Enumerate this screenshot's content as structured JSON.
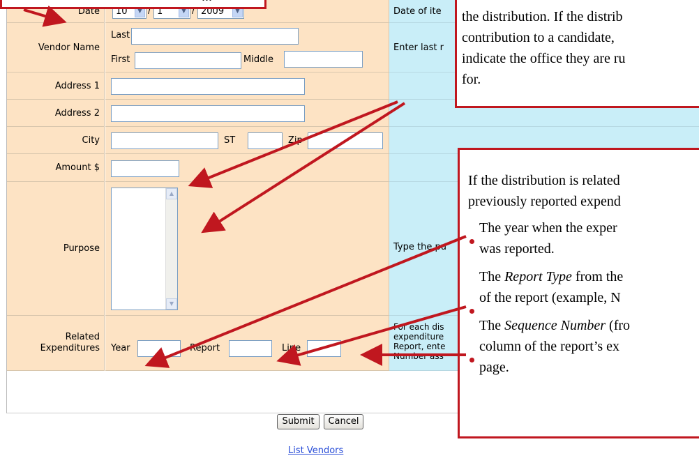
{
  "top_callout_fragment": "...",
  "form": {
    "date": {
      "label": "Date",
      "month": "10",
      "day": "1",
      "year": "2009",
      "sep": "/"
    },
    "vendor": {
      "label": "Vendor Name",
      "last_label": "Last",
      "first_label": "First",
      "middle_label": "Middle"
    },
    "address1": {
      "label": "Address 1"
    },
    "address2": {
      "label": "Address 2"
    },
    "city": {
      "label": "City",
      "st_label": "ST",
      "zip_label": "Zip"
    },
    "amount": {
      "label": "Amount $"
    },
    "purpose": {
      "label": "Purpose"
    },
    "related": {
      "label_line1": "Related",
      "label_line2": "Expenditures",
      "year_label": "Year",
      "report_label": "Report",
      "line_label": "Line"
    }
  },
  "help": {
    "date": "Date of ite",
    "vendor": "Enter last r",
    "purpose": "Type the pu",
    "related": [
      "For each dis",
      "expenditure",
      "Report, ente",
      "Number ass"
    ]
  },
  "buttons": {
    "submit": "Submit",
    "cancel": "Cancel"
  },
  "links": {
    "list_vendors": "List Vendors"
  },
  "callout_right_top": [
    "the distribution. If the distrib",
    "contribution to a candidate,",
    "indicate the office they are ru",
    "for."
  ],
  "callout_right_bottom": {
    "intro": [
      "If the distribution is related",
      "previously reported expend"
    ],
    "b1": [
      "The year when the exper",
      "was reported."
    ],
    "b2_pre": "The ",
    "b2_italic": "Report Type",
    "b2_post": " from the",
    "b2_l2": "of the report (example, N",
    "b3_pre": "The ",
    "b3_italic": "Sequence Number",
    "b3_post": " (fro",
    "b3_l2": "column of the report’s ex",
    "b3_l3": "page."
  },
  "colors": {
    "label_bg": "#fde3c4",
    "help_bg": "#c9eef8",
    "callout_red": "#c0171f",
    "link": "#2b4fd8"
  }
}
